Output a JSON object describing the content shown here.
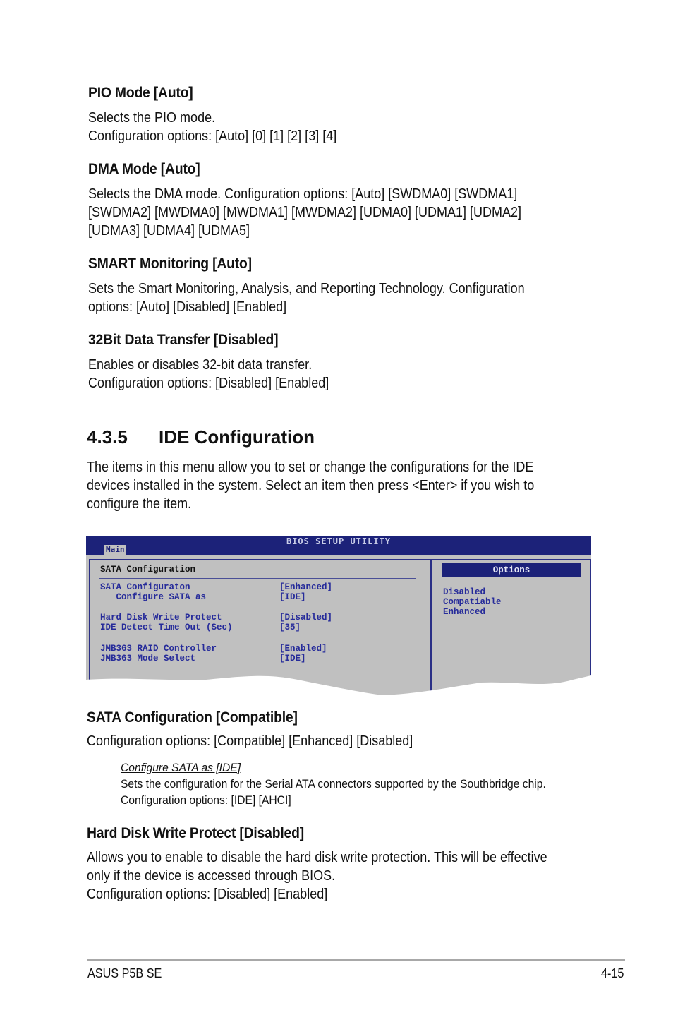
{
  "sections": [
    {
      "title": "PIO Mode [Auto]",
      "lines": [
        "Selects the PIO mode.",
        "Configuration options: [Auto] [0] [1] [2] [3] [4]"
      ]
    },
    {
      "title": "DMA Mode [Auto]",
      "lines": [
        "Selects the DMA mode. Configuration options: [Auto] [SWDMA0] [SWDMA1]",
        "[SWDMA2] [MWDMA0] [MWDMA1] [MWDMA2] [UDMA0] [UDMA1] [UDMA2]",
        "[UDMA3] [UDMA4] [UDMA5]"
      ]
    },
    {
      "title": "SMART Monitoring [Auto]",
      "lines": [
        "Sets the Smart Monitoring, Analysis, and Reporting Technology. Configuration",
        "options: [Auto] [Disabled] [Enabled]"
      ]
    },
    {
      "title": "32Bit Data Transfer [Disabled]",
      "lines": [
        "Enables or disables 32-bit data transfer.",
        "Configuration options: [Disabled] [Enabled]"
      ]
    }
  ],
  "heading": {
    "number": "4.3.5",
    "title": "IDE Configuration"
  },
  "intro": [
    "The items in this menu allow you to set or change the configurations for the IDE",
    "devices installed in the system. Select an item then press <Enter> if you wish to",
    "configure the item."
  ],
  "bios": {
    "title": "BIOS SETUP UTILITY",
    "tab": "Main",
    "panel_title": "SATA Configuration",
    "rows": [
      {
        "label": "SATA Configuraton",
        "value": "[Enhanced]"
      },
      {
        "label": "   Configure SATA as",
        "value": "[IDE]"
      },
      {
        "label": "Hard Disk Write Protect",
        "value": "[Disabled]"
      },
      {
        "label": "IDE Detect Time Out (Sec)",
        "value": "[35]"
      },
      {
        "label": "JMB363 RAID Controller",
        "value": "[Enabled]"
      },
      {
        "label": "JMB363 Mode Select",
        "value": "[IDE]"
      }
    ],
    "options_title": "Options",
    "options": [
      "Disabled",
      "Compatiable",
      "Enhanced"
    ]
  },
  "sata_section": {
    "title": "SATA Configuration [Compatible]",
    "line": "Configuration options: [Compatible] [Enhanced] [Disabled]",
    "sub": {
      "title": "Configure SATA as [IDE]",
      "lines": [
        "Sets the configuration for the Serial ATA connectors supported by the Southbridge chip.",
        "Configuration options: [IDE] [AHCI]"
      ]
    }
  },
  "hdwp_section": {
    "title": "Hard Disk Write Protect [Disabled]",
    "lines": [
      "Allows you to enable to disable the hard disk write protection. This will be effective",
      "only if the device is accessed through BIOS.",
      "Configuration options: [Disabled] [Enabled]"
    ]
  },
  "footer": {
    "left": "ASUS P5B SE",
    "right": "4-15"
  }
}
